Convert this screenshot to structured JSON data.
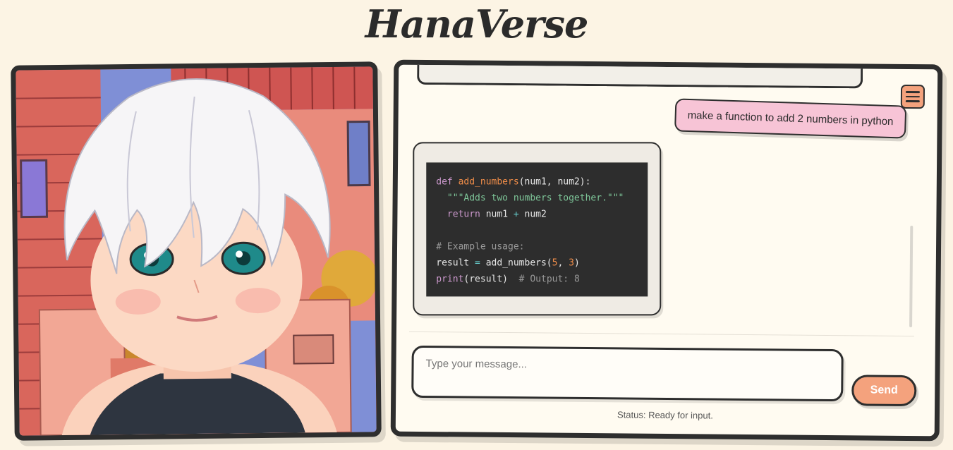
{
  "app": {
    "title": "HanaVerse"
  },
  "avatar": {
    "icon": "anime-girl-avatar",
    "description_visible": false
  },
  "chat": {
    "menu_icon": "hamburger-menu-icon",
    "user_message": "make a function to add 2 numbers in python",
    "bot_message": {
      "code_lines": [
        "def add_numbers(num1, num2):",
        "  \"\"\"Adds two numbers together.\"\"\"",
        "  return num1 + num2",
        "",
        "# Example usage:",
        "result = add_numbers(5, 3)",
        "print(result)  # Output: 8"
      ]
    },
    "input": {
      "placeholder": "Type your message...",
      "value": ""
    },
    "send_label": "Send",
    "status": "Status: Ready for input."
  },
  "colors": {
    "background": "#fcf4e4",
    "accent": "#f4a27d",
    "user_bubble": "#f7c4d6",
    "code_bg": "#2d2d2d"
  }
}
